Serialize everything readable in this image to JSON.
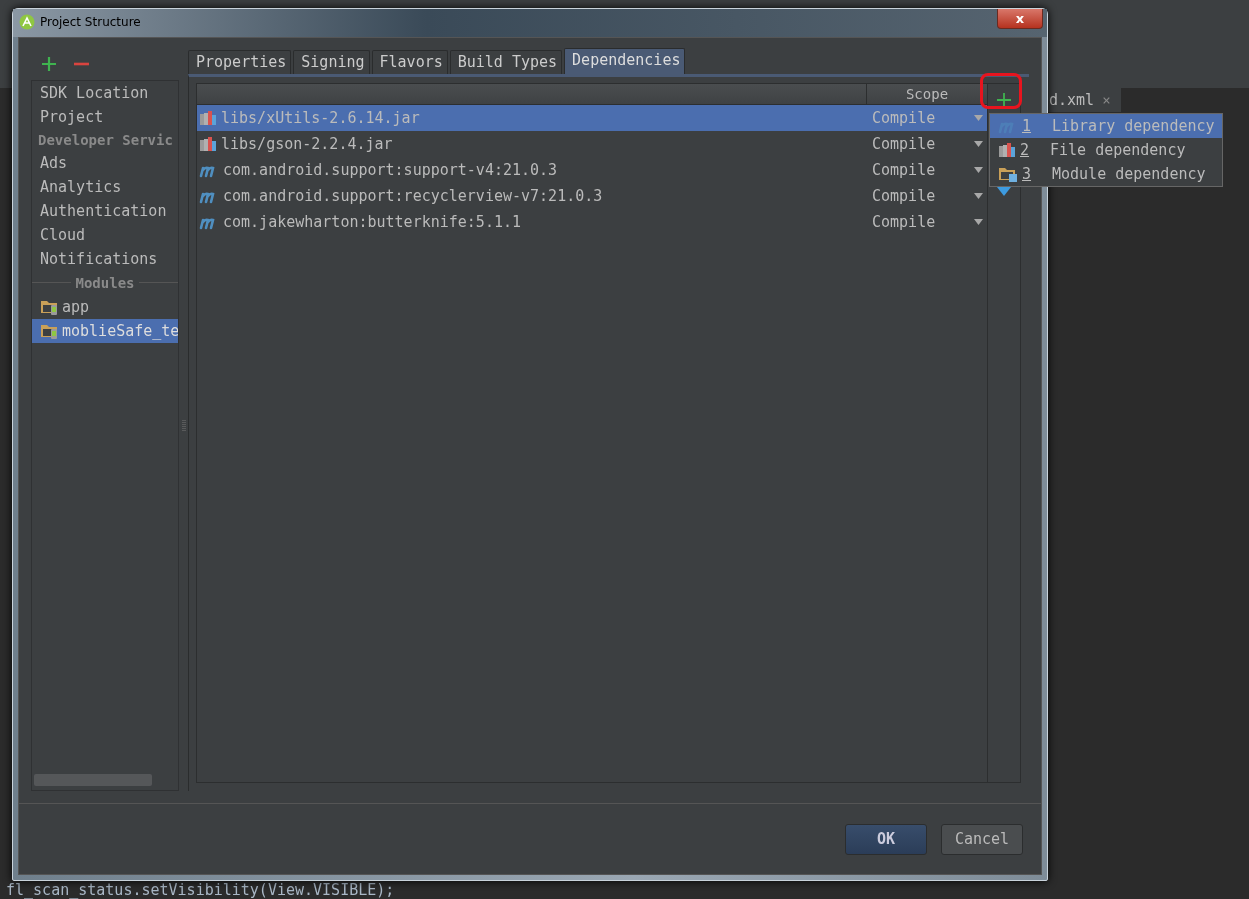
{
  "ide": {
    "editor_tab": {
      "label": "d.xml",
      "close": "×"
    },
    "code_line": "fl_scan_status.setVisibility(View.VISIBLE);"
  },
  "window": {
    "title": "Project Structure",
    "close": "x"
  },
  "sidebar": {
    "items": [
      {
        "kind": "item",
        "label": "SDK Location",
        "selected": false
      },
      {
        "kind": "item",
        "label": "Project",
        "selected": false
      },
      {
        "kind": "header",
        "label": "Developer Servic"
      },
      {
        "kind": "item",
        "label": "Ads",
        "selected": false
      },
      {
        "kind": "item",
        "label": "Analytics",
        "selected": false
      },
      {
        "kind": "item",
        "label": "Authentication",
        "selected": false
      },
      {
        "kind": "item",
        "label": "Cloud",
        "selected": false
      },
      {
        "kind": "item",
        "label": "Notifications",
        "selected": false
      },
      {
        "kind": "divider",
        "label": "Modules"
      },
      {
        "kind": "module",
        "label": "app",
        "selected": false
      },
      {
        "kind": "module",
        "label": "moblieSafe_te",
        "selected": true
      }
    ]
  },
  "tabs": [
    {
      "label": "Properties",
      "selected": false
    },
    {
      "label": "Signing",
      "selected": false
    },
    {
      "label": "Flavors",
      "selected": false
    },
    {
      "label": "Build Types",
      "selected": false
    },
    {
      "label": "Dependencies",
      "selected": true
    }
  ],
  "table": {
    "columns": [
      {
        "label": "Scope"
      }
    ],
    "rows": [
      {
        "kind": "jar",
        "name": "libs/xUtils-2.6.14.jar",
        "scope": "Compile",
        "selected": true
      },
      {
        "kind": "jar",
        "name": "libs/gson-2.2.4.jar",
        "scope": "Compile",
        "selected": false
      },
      {
        "kind": "maven",
        "name": "com.android.support:support-v4:21.0.3",
        "scope": "Compile",
        "selected": false
      },
      {
        "kind": "maven",
        "name": "com.android.support:recyclerview-v7:21.0.3",
        "scope": "Compile",
        "selected": false
      },
      {
        "kind": "maven",
        "name": "com.jakewharton:butterknife:5.1.1",
        "scope": "Compile",
        "selected": false
      }
    ]
  },
  "add_menu": {
    "items": [
      {
        "kind": "maven",
        "number": "1",
        "label": "Library dependency",
        "selected": true
      },
      {
        "kind": "jar",
        "number": "2",
        "label": "File dependency",
        "selected": false
      },
      {
        "kind": "module",
        "number": "3",
        "label": "Module dependency",
        "selected": false
      }
    ]
  },
  "buttons": [
    {
      "label": "OK",
      "default": true
    },
    {
      "label": "Cancel",
      "default": false
    }
  ]
}
